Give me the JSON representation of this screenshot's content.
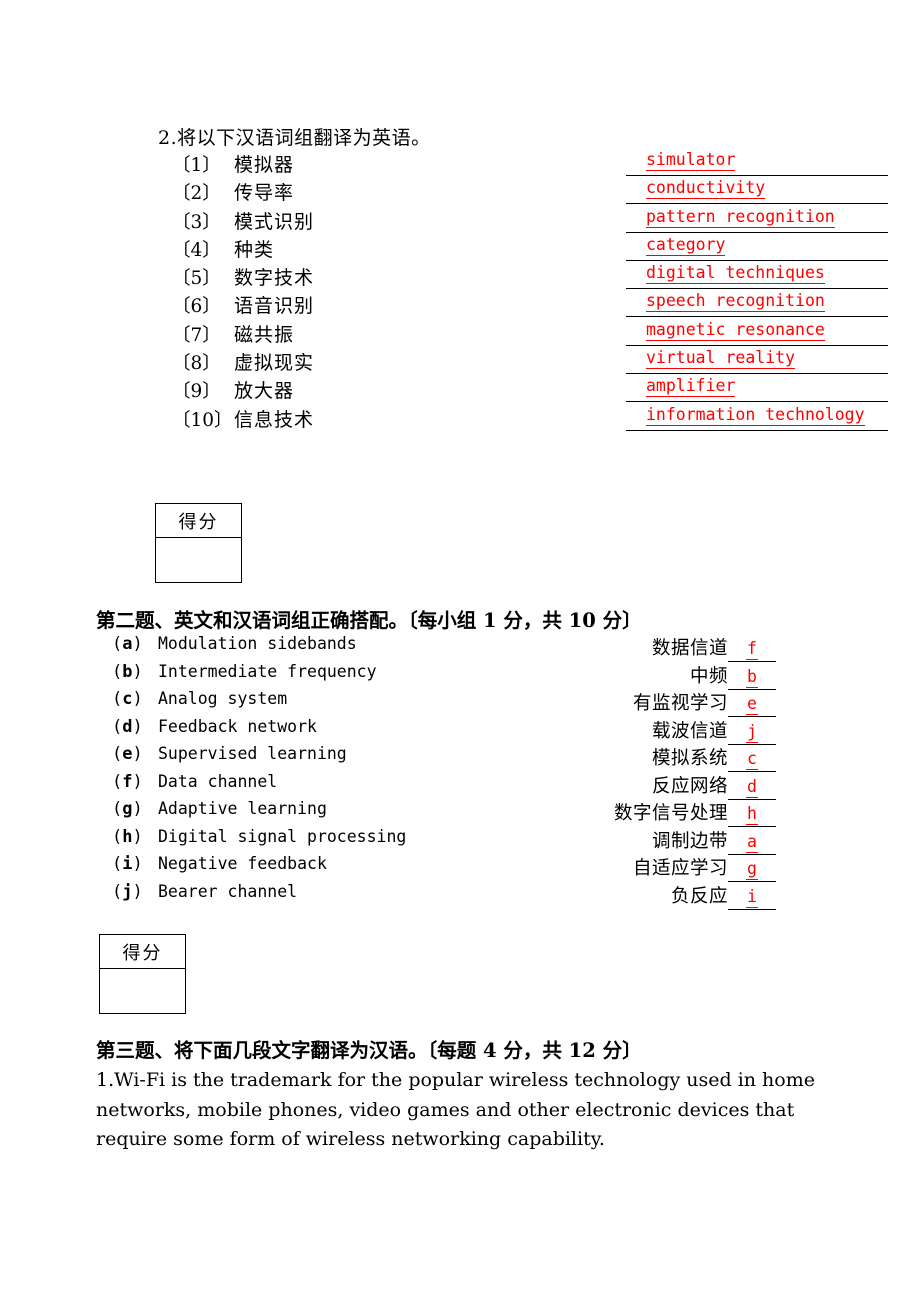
{
  "section1": {
    "title": "2.将以下汉语词组翻译为英语。",
    "items": [
      {
        "num": "〔1〕",
        "cn": "模拟器",
        "answer": "simulator"
      },
      {
        "num": "〔2〕",
        "cn": "传导率",
        "answer": "conductivity"
      },
      {
        "num": "〔3〕",
        "cn": "模式识别",
        "answer": "pattern recognition"
      },
      {
        "num": "〔4〕",
        "cn": "种类",
        "answer": "category"
      },
      {
        "num": "〔5〕",
        "cn": "数字技术",
        "answer": "digital techniques"
      },
      {
        "num": "〔6〕",
        "cn": "语音识别",
        "answer": "speech recognition"
      },
      {
        "num": "〔7〕",
        "cn": "磁共振",
        "answer": "magnetic resonance"
      },
      {
        "num": "〔8〕",
        "cn": "虚拟现实",
        "answer": "virtual reality"
      },
      {
        "num": "〔9〕",
        "cn": "放大器",
        "answer": "amplifier"
      },
      {
        "num": "〔10〕",
        "cn": "信息技术",
        "answer": "information technology"
      }
    ]
  },
  "score_box_1": {
    "label": "得分",
    "value": ""
  },
  "score_box_2": {
    "label": "得分",
    "value": ""
  },
  "section2": {
    "heading": "第二题、英文和汉语词组正确搭配。〔每小组 1 分，共 10 分〕",
    "rows": [
      {
        "letter": "a",
        "en": "Modulation sidebands",
        "cn": "数据信道",
        "answer": "f"
      },
      {
        "letter": "b",
        "en": "Intermediate frequency",
        "cn": "中频",
        "answer": "b"
      },
      {
        "letter": "c",
        "en": "Analog  system",
        "cn": "有监视学习",
        "answer": "e"
      },
      {
        "letter": "d",
        "en": "Feedback network",
        "cn": "载波信道",
        "answer": "j"
      },
      {
        "letter": "e",
        "en": "Supervised learning",
        "cn": "模拟系统",
        "answer": "c"
      },
      {
        "letter": "f",
        "en": "Data channel",
        "cn": "反应网络",
        "answer": "d"
      },
      {
        "letter": "g",
        "en": "Adaptive learning",
        "cn": "数字信号处理",
        "answer": "h"
      },
      {
        "letter": "h",
        "en": "Digital signal processing",
        "cn": "调制边带",
        "answer": "a"
      },
      {
        "letter": "i",
        "en": "Negative feedback",
        "cn": "自适应学习",
        "answer": "g"
      },
      {
        "letter": "j",
        "en": "Bearer channel",
        "cn": "负反应",
        "answer": "i"
      }
    ]
  },
  "section3": {
    "heading": "第三题、将下面几段文字翻译为汉语。〔每题 4 分，共 12 分〕",
    "paragraph": "1.Wi-Fi is the trademark for the popular wireless technology used in home networks, mobile phones, video games and other electronic devices that require some form of wireless networking capability."
  },
  "colors": {
    "answer_red": "#ff0000",
    "text_black": "#000000",
    "page_background": "#ffffff"
  }
}
